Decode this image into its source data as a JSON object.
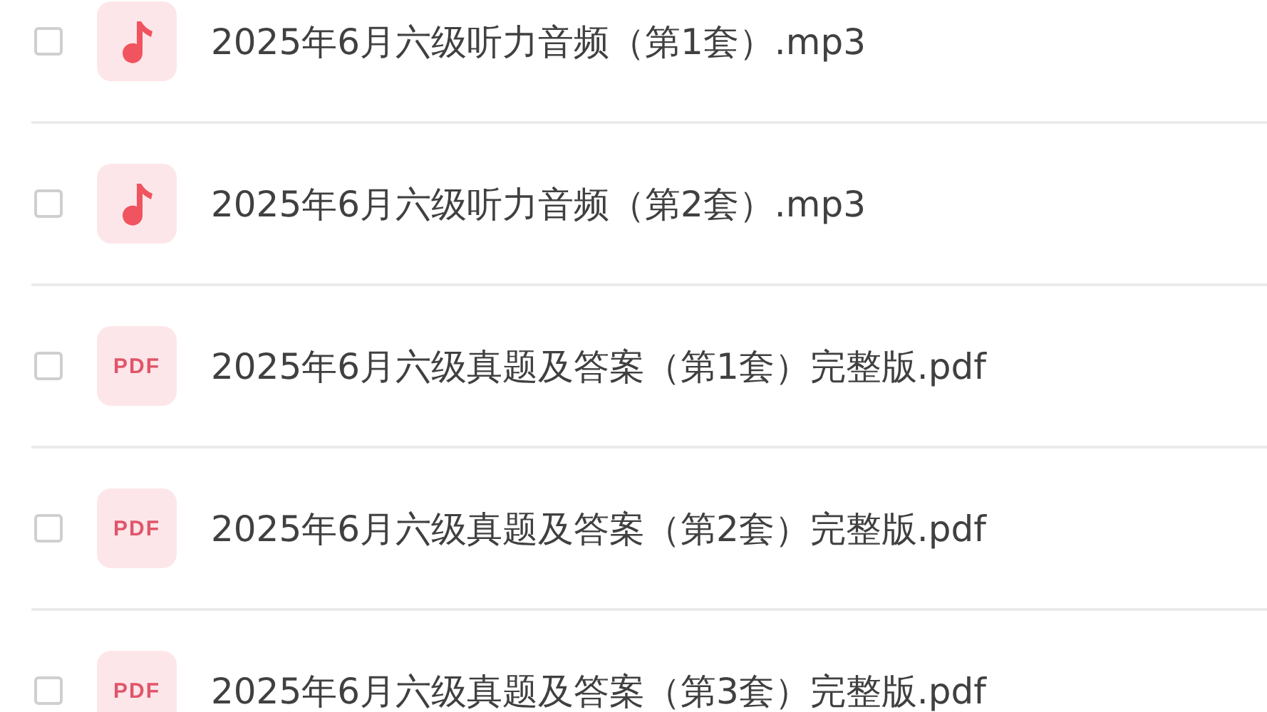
{
  "files": [
    {
      "kind": "audio",
      "name": "2025年6月六级听力音频（第1套）.mp3",
      "checked": false
    },
    {
      "kind": "audio",
      "name": "2025年6月六级听力音频（第2套）.mp3",
      "checked": false
    },
    {
      "kind": "pdf",
      "badge": "PDF",
      "name": "2025年6月六级真题及答案（第1套）完整版.pdf",
      "checked": false
    },
    {
      "kind": "pdf",
      "badge": "PDF",
      "name": "2025年6月六级真题及答案（第2套）完整版.pdf",
      "checked": false
    },
    {
      "kind": "pdf",
      "badge": "PDF",
      "name": "2025年6月六级真题及答案（第3套）完整版.pdf",
      "checked": false
    }
  ]
}
